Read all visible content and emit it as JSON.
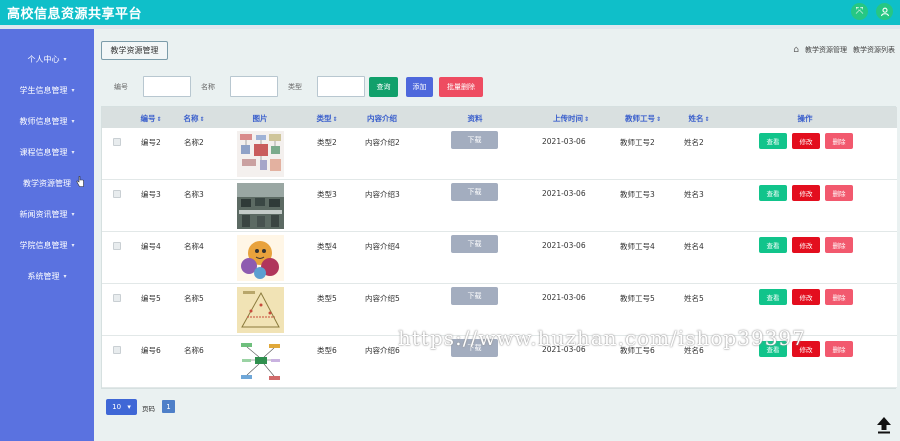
{
  "app": {
    "title": "高校信息资源共享平台"
  },
  "topbar": {
    "icons": [
      "fullscreen-icon",
      "user-icon"
    ]
  },
  "sidebar": {
    "items": [
      {
        "label": "个人中心",
        "has_chevron": true
      },
      {
        "label": "学生信息管理",
        "has_chevron": true
      },
      {
        "label": "教师信息管理",
        "has_chevron": true
      },
      {
        "label": "课程信息管理",
        "has_chevron": true
      },
      {
        "label": "教学资源管理",
        "has_chevron": false
      },
      {
        "label": "新闻资讯管理",
        "has_chevron": true
      },
      {
        "label": "学院信息管理",
        "has_chevron": true
      },
      {
        "label": "系统管理",
        "has_chevron": true
      }
    ],
    "chevron": "▾"
  },
  "main": {
    "tab_label": "教学资源管理",
    "breadcrumb": [
      "教学资源管理",
      "教学资源列表"
    ]
  },
  "search": {
    "fields": [
      {
        "label": "编号",
        "value": ""
      },
      {
        "label": "名称",
        "value": ""
      },
      {
        "label": "类型",
        "value": ""
      }
    ],
    "query_label": "查询",
    "add_label": "添加",
    "batch_delete_label": "批量删除"
  },
  "table": {
    "headers": [
      {
        "label": "编号",
        "sortable": true
      },
      {
        "label": "名称",
        "sortable": true
      },
      {
        "label": "图片",
        "sortable": false
      },
      {
        "label": "类型",
        "sortable": true
      },
      {
        "label": "内容介绍",
        "sortable": false
      },
      {
        "label": "资料",
        "sortable": false
      },
      {
        "label": "上传时间",
        "sortable": true
      },
      {
        "label": "教师工号",
        "sortable": true
      },
      {
        "label": "姓名",
        "sortable": true
      },
      {
        "label": "操作",
        "sortable": false
      }
    ],
    "sort_icon": "⇕",
    "download_label": "下载",
    "view_label": "查看",
    "edit_label": "修改",
    "delete_label": "删除",
    "rows": [
      {
        "id": "编号2",
        "name": "名称2",
        "image": "thumbnail-flowchart",
        "type": "类型2",
        "intro": "内容介绍2",
        "time": "2021-03-06",
        "teacher_no": "教师工号2",
        "teacher_name": "姓名2"
      },
      {
        "id": "编号3",
        "name": "名称3",
        "image": "thumbnail-classroom",
        "type": "类型3",
        "intro": "内容介绍3",
        "time": "2021-03-06",
        "teacher_no": "教师工号3",
        "teacher_name": "姓名3"
      },
      {
        "id": "编号4",
        "name": "名称4",
        "image": "thumbnail-cartoon",
        "type": "类型4",
        "intro": "内容介绍4",
        "time": "2021-03-06",
        "teacher_no": "教师工号4",
        "teacher_name": "姓名4"
      },
      {
        "id": "编号5",
        "name": "名称5",
        "image": "thumbnail-diagram",
        "type": "类型5",
        "intro": "内容介绍5",
        "time": "2021-03-06",
        "teacher_no": "教师工号5",
        "teacher_name": "姓名5"
      },
      {
        "id": "编号6",
        "name": "名称6",
        "image": "thumbnail-mindmap",
        "type": "类型6",
        "intro": "内容介绍6",
        "time": "2021-03-06",
        "teacher_no": "教师工号6",
        "teacher_name": "姓名6"
      }
    ]
  },
  "pagination": {
    "page_size": "10",
    "page_label": "页码",
    "current_page": "1"
  },
  "watermark": "https://www.huzhan.com/ishop39397",
  "colors": {
    "topbar": "#0fbfc9",
    "sidebar": "#5a72e0",
    "accent": "#3a5fcc"
  }
}
